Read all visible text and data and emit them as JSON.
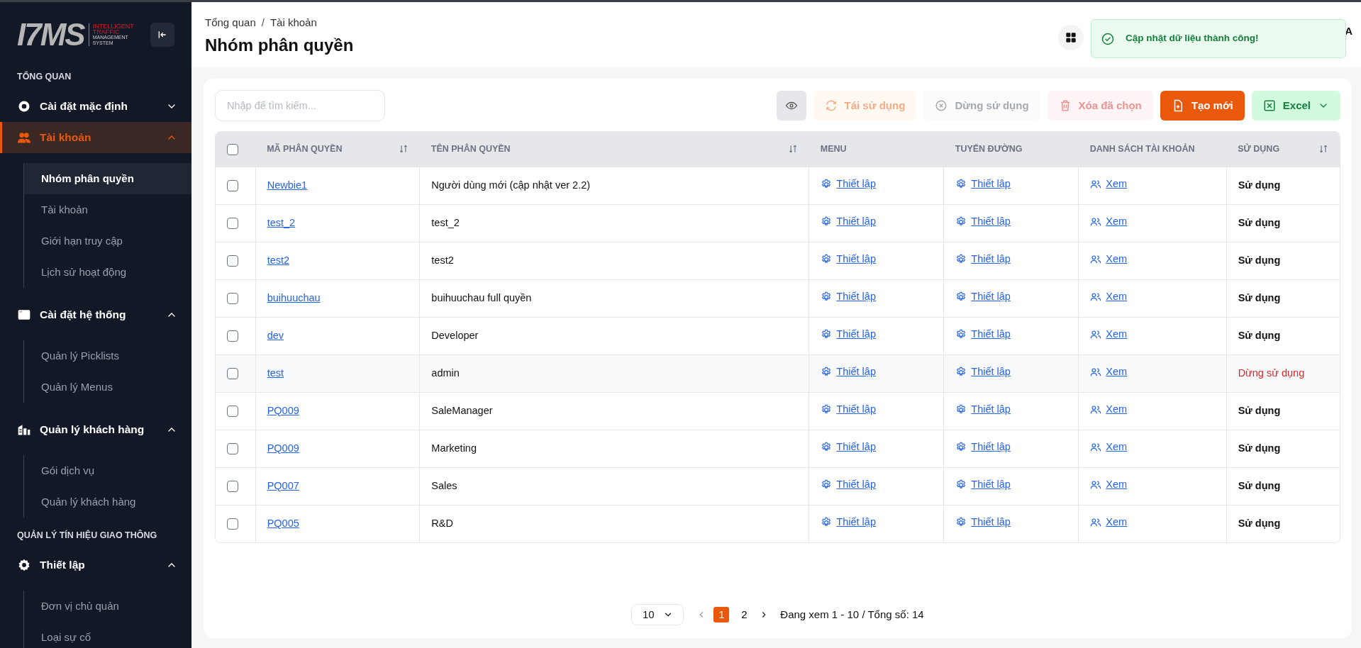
{
  "sidebar": {
    "logo": {
      "letters": "I7MS",
      "tagline_lines": [
        "INTELLIGENT",
        "TRAFFIC",
        "MANAGEMENT",
        "SYSTEM"
      ]
    },
    "sections": [
      {
        "title": "TỔNG QUAN",
        "items": [
          {
            "label": "Cài đặt mặc định",
            "expanded": false,
            "selected": false
          },
          {
            "label": "Tài khoản",
            "expanded": true,
            "selected": true,
            "children": [
              {
                "label": "Nhóm phân quyền",
                "selected": true
              },
              {
                "label": "Tài khoản",
                "selected": false
              },
              {
                "label": "Giới hạn truy cập",
                "selected": false
              },
              {
                "label": "Lịch sử hoạt động",
                "selected": false
              }
            ]
          },
          {
            "label": "Cài đặt hệ thống",
            "expanded": true,
            "selected": false,
            "children": [
              {
                "label": "Quản lý Picklists",
                "selected": false
              },
              {
                "label": "Quản lý Menus",
                "selected": false
              }
            ]
          },
          {
            "label": "Quản lý khách hàng",
            "expanded": true,
            "selected": false,
            "children": [
              {
                "label": "Gói dịch vụ",
                "selected": false
              },
              {
                "label": "Quản lý khách hàng",
                "selected": false
              }
            ]
          }
        ]
      },
      {
        "title": "QUẢN LÝ TÍN HIỆU GIAO THÔNG",
        "items": [
          {
            "label": "Thiết lập",
            "expanded": true,
            "selected": false,
            "children": [
              {
                "label": "Đơn vị chủ quản",
                "selected": false
              },
              {
                "label": "Loại sự cố",
                "selected": false
              }
            ]
          }
        ]
      }
    ]
  },
  "header": {
    "breadcrumb": [
      "Tổng quan",
      "Tài khoản"
    ],
    "breadcrumb_separator": "/",
    "title": "Nhóm phân quyền",
    "user_fragment": "A"
  },
  "toast": {
    "message": "Cập nhật dữ liệu thành công!"
  },
  "toolbar": {
    "search": {
      "placeholder": "Nhập để tìm kiếm..."
    },
    "buttons": [
      {
        "kind": "view",
        "disabled": false
      },
      {
        "kind": "reuse",
        "label": "Tái sử dụng",
        "disabled": true
      },
      {
        "kind": "stop",
        "label": "Dừng sử dụng",
        "disabled": true
      },
      {
        "kind": "delete",
        "label": "Xóa đã chọn",
        "disabled": true
      },
      {
        "kind": "create",
        "label": "Tạo mới",
        "disabled": false
      },
      {
        "kind": "excel",
        "label": "Excel",
        "disabled": false
      }
    ]
  },
  "table": {
    "header_checked": false,
    "columns": [
      {
        "label": "MÃ PHÂN QUYỀN",
        "sortable": true
      },
      {
        "label": "TÊN PHÂN QUYỀN",
        "sortable": true
      },
      {
        "label": "MENU",
        "sortable": false
      },
      {
        "label": "TUYẾN ĐƯỜNG",
        "sortable": false
      },
      {
        "label": "DANH SÁCH TÀI KHOẢN",
        "sortable": false
      },
      {
        "label": "SỬ DỤNG",
        "sortable": true
      }
    ],
    "rows": [
      {
        "checked": false,
        "hovered": false,
        "code": "Newbie1",
        "name": "Người dùng mới (cập nhật ver 2.2)",
        "menu": "Thiết lập",
        "route": "Thiết lập",
        "accounts": "Xem",
        "status": "Sử dụng",
        "active": true
      },
      {
        "checked": false,
        "hovered": false,
        "code": "test_2",
        "name": "test_2",
        "menu": "Thiết lập",
        "route": "Thiết lập",
        "accounts": "Xem",
        "status": "Sử dụng",
        "active": true
      },
      {
        "checked": false,
        "hovered": false,
        "code": "test2",
        "name": "test2",
        "menu": "Thiết lập",
        "route": "Thiết lập",
        "accounts": "Xem",
        "status": "Sử dụng",
        "active": true
      },
      {
        "checked": false,
        "hovered": false,
        "code": "buihuuchau",
        "name": "buihuuchau full quyền",
        "menu": "Thiết lập",
        "route": "Thiết lập",
        "accounts": "Xem",
        "status": "Sử dụng",
        "active": true
      },
      {
        "checked": false,
        "hovered": false,
        "code": "dev",
        "name": "Developer",
        "menu": "Thiết lập",
        "route": "Thiết lập",
        "accounts": "Xem",
        "status": "Sử dụng",
        "active": true
      },
      {
        "checked": false,
        "hovered": true,
        "code": "test",
        "name": "admin",
        "menu": "Thiết lập",
        "route": "Thiết lập",
        "accounts": "Xem",
        "status": "Dừng sử dụng",
        "active": false
      },
      {
        "checked": false,
        "hovered": false,
        "code": "PQ009",
        "name": "SaleManager",
        "menu": "Thiết lập",
        "route": "Thiết lập",
        "accounts": "Xem",
        "status": "Sử dụng",
        "active": true
      },
      {
        "checked": false,
        "hovered": false,
        "code": "PQ009",
        "name": "Marketing",
        "menu": "Thiết lập",
        "route": "Thiết lập",
        "accounts": "Xem",
        "status": "Sử dụng",
        "active": true
      },
      {
        "checked": false,
        "hovered": false,
        "code": "PQ007",
        "name": "Sales",
        "menu": "Thiết lập",
        "route": "Thiết lập",
        "accounts": "Xem",
        "status": "Sử dụng",
        "active": true
      },
      {
        "checked": false,
        "hovered": false,
        "code": "PQ005",
        "name": "R&D",
        "menu": "Thiết lập",
        "route": "Thiết lập",
        "accounts": "Xem",
        "status": "Sử dụng",
        "active": true
      }
    ]
  },
  "pagination": {
    "page_size": "10",
    "pages": [
      {
        "label": "1",
        "selected": true
      },
      {
        "label": "2",
        "selected": false
      }
    ],
    "info": "Đang xem 1 - 10 / Tổng số: 14"
  }
}
